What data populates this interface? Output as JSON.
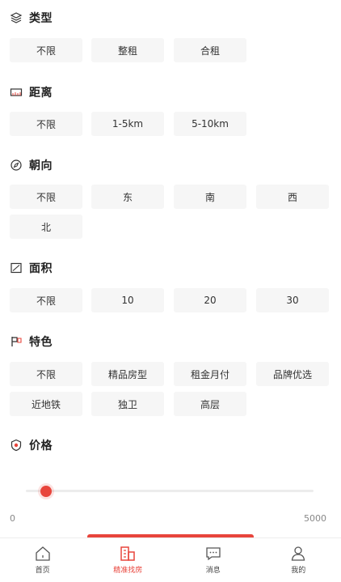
{
  "filters": {
    "type": {
      "title": "类型",
      "options": [
        "不限",
        "整租",
        "合租"
      ]
    },
    "distance": {
      "title": "距离",
      "options": [
        "不限",
        "1-5km",
        "5-10km"
      ]
    },
    "orientation": {
      "title": "朝向",
      "options": [
        "不限",
        "东",
        "南",
        "西",
        "北"
      ]
    },
    "area": {
      "title": "面积",
      "options": [
        "不限",
        "10",
        "20",
        "30"
      ]
    },
    "feature": {
      "title": "特色",
      "options": [
        "不限",
        "精品房型",
        "租金月付",
        "品牌优选",
        "近地铁",
        "独卫",
        "高层"
      ]
    },
    "price": {
      "title": "价格",
      "min_label": "0",
      "max_label": "5000",
      "value_fraction": 0.07
    }
  },
  "tabbar": {
    "items": [
      {
        "label": "首页"
      },
      {
        "label": "精准找房"
      },
      {
        "label": "消息"
      },
      {
        "label": "我的"
      }
    ],
    "active_index": 1
  },
  "colors": {
    "accent": "#e8453c",
    "chip_bg": "#f6f6f6"
  }
}
